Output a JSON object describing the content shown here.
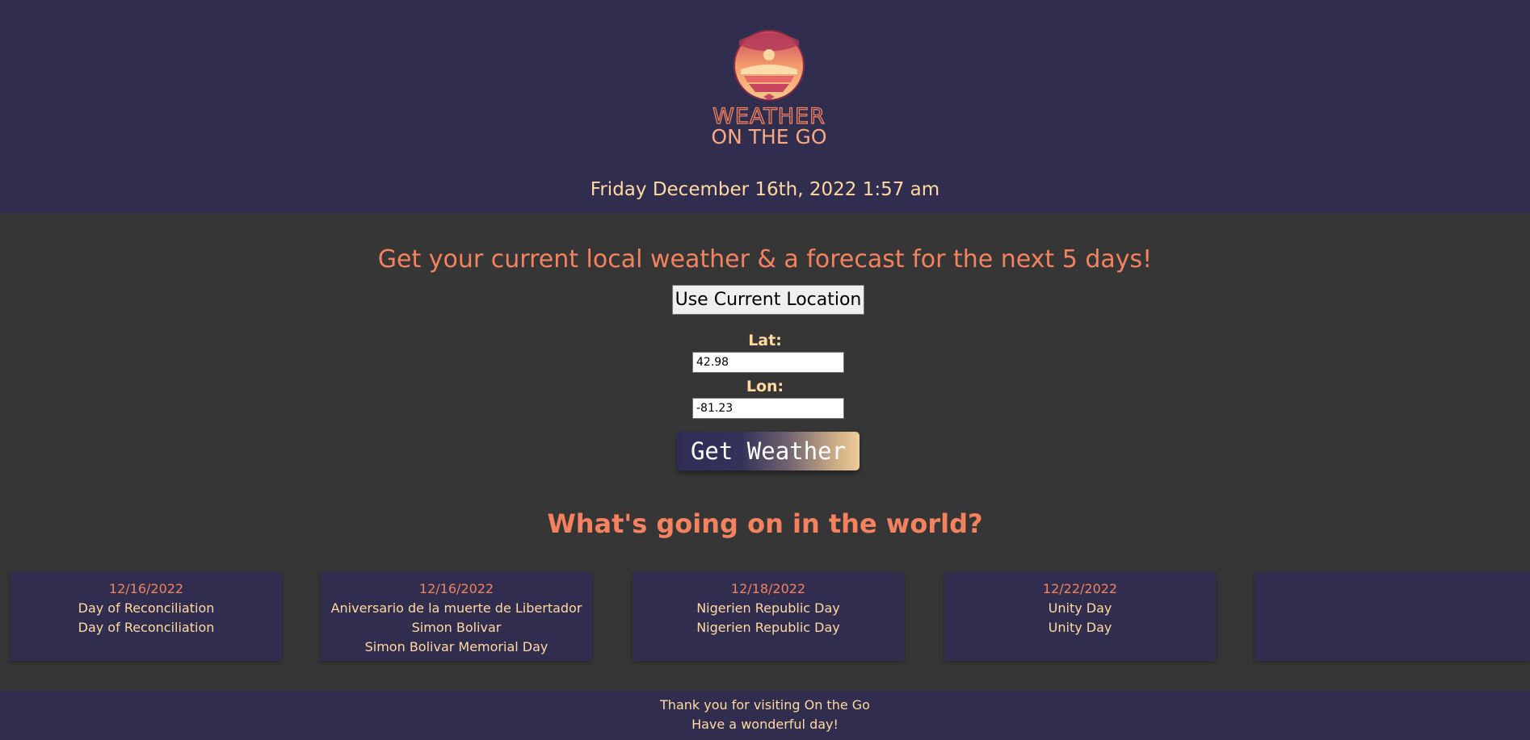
{
  "header": {
    "logo_line1": "WEATHER",
    "logo_line2": "ON THE GO",
    "datetime": "Friday December 16th, 2022 1:57 am"
  },
  "main": {
    "tagline": "Get your current local weather & a forecast for the next 5 days!",
    "use_location_label": "Use Current Location",
    "lat_label": "Lat:",
    "lat_value": "42.98",
    "lon_label": "Lon:",
    "lon_value": "-81.23",
    "get_weather_label": "Get Weather"
  },
  "events": {
    "title": "What's going on in the world?",
    "cards": [
      {
        "date": "12/16/2022",
        "line1": "Day of Reconciliation",
        "line2": "Day of Reconciliation"
      },
      {
        "date": "12/16/2022",
        "line1": "Aniversario de la muerte de Libertador Simon Bolivar",
        "line2": "Simon Bolivar Memorial Day"
      },
      {
        "date": "12/18/2022",
        "line1": "Nigerien Republic Day",
        "line2": "Nigerien Republic Day"
      },
      {
        "date": "12/22/2022",
        "line1": "Unity Day",
        "line2": "Unity Day"
      },
      {
        "date": "",
        "line1": "",
        "line2": ""
      }
    ]
  },
  "footer": {
    "line1": "Thank you for visiting On the Go",
    "line2": "Have a wonderful day!"
  },
  "colors": {
    "header_bg": "#302d4e",
    "body_bg": "#363636",
    "accent": "#f4825f",
    "text_light": "#ffd9a1"
  }
}
